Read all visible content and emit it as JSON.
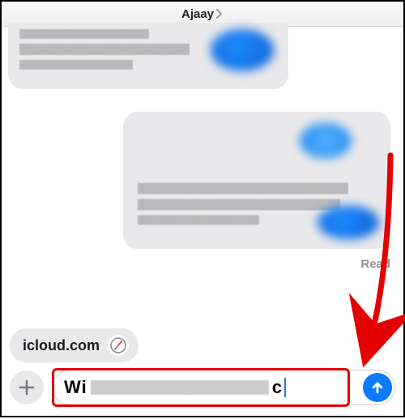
{
  "header": {
    "contact_name": "Ajaay"
  },
  "thread": {
    "read_receipt": "Read"
  },
  "link_preview": {
    "domain": "icloud.com"
  },
  "composer": {
    "input_start": "Wi",
    "input_end": "c"
  },
  "icons": {
    "chevron": "chevron-right-icon",
    "safari": "safari-icon",
    "plus": "plus-icon",
    "send": "send-up-icon"
  },
  "annotation": {
    "type": "arrow",
    "color": "#e30000"
  }
}
